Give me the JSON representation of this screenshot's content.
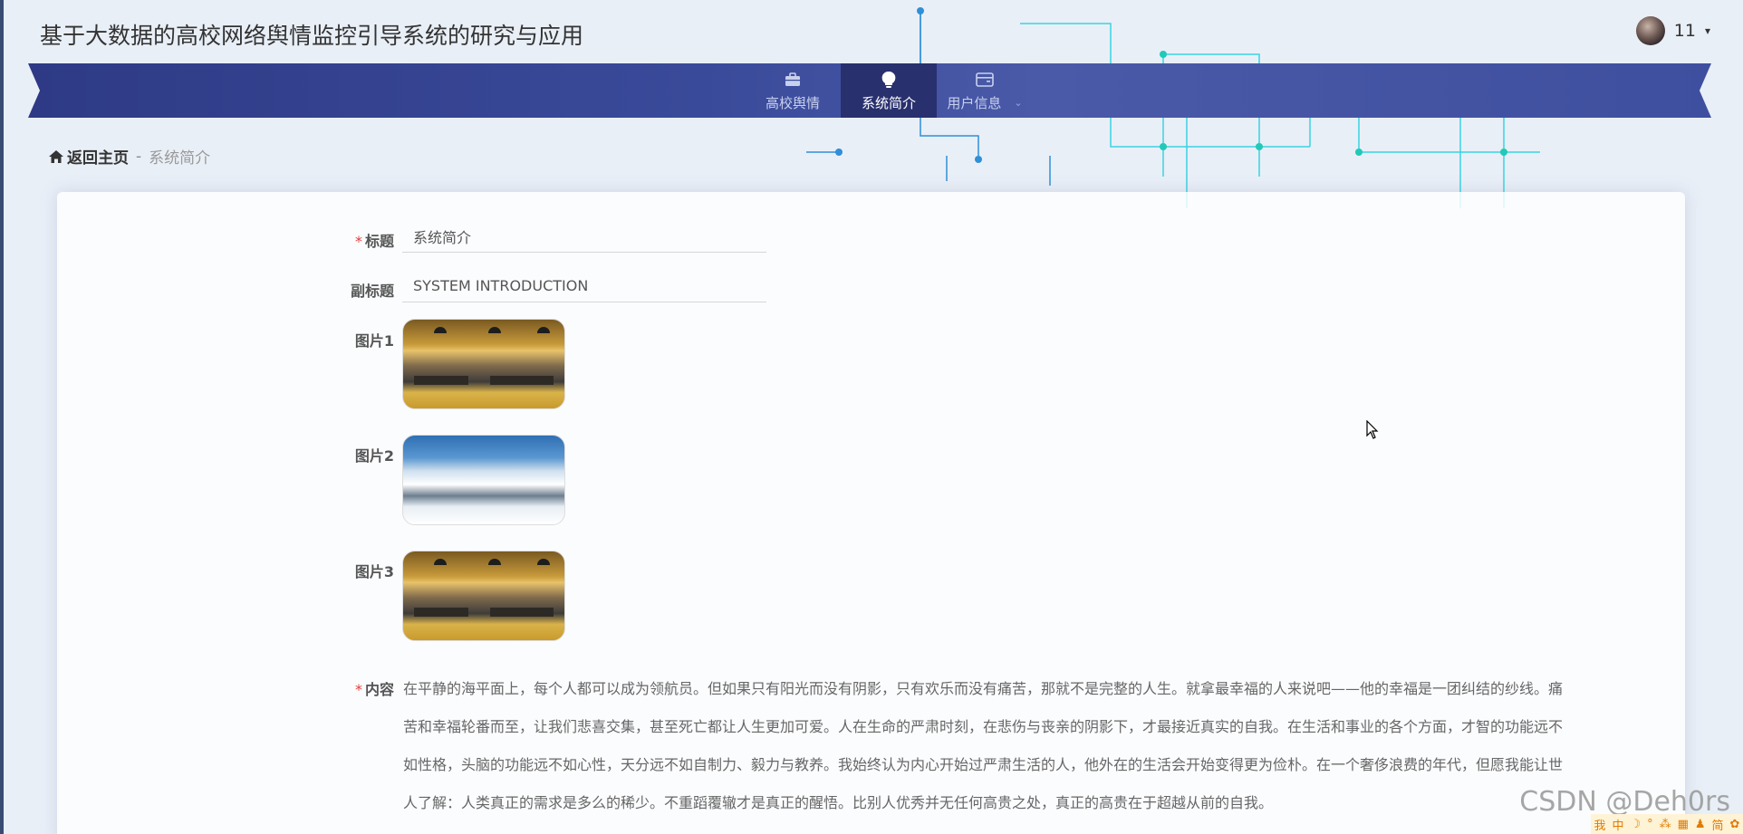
{
  "header": {
    "title": "基于大数据的高校网络舆情监控引导系统的研究与应用",
    "user_name": "11",
    "user_caret": "▾"
  },
  "nav": {
    "items": [
      {
        "label": "高校舆情",
        "icon": "briefcase-icon",
        "active": false
      },
      {
        "label": "系统简介",
        "icon": "lightbulb-icon",
        "active": true
      },
      {
        "label": "用户信息",
        "icon": "card-icon",
        "active": false,
        "has_dropdown": true
      }
    ],
    "dropdown_caret": "⌄"
  },
  "breadcrumb": {
    "home_label": "返回主页",
    "separator": "-",
    "current": "系统简介"
  },
  "form": {
    "title_label": "标题",
    "title_required": "*",
    "title_value": "系统简介",
    "subtitle_label": "副标题",
    "subtitle_value": "SYSTEM INTRODUCTION",
    "image1_label": "图片1",
    "image2_label": "图片2",
    "image3_label": "图片3",
    "content_label": "内容",
    "content_required": "*",
    "content_text": "在平静的海平面上，每个人都可以成为领航员。但如果只有阳光而没有阴影，只有欢乐而没有痛苦，那就不是完整的人生。就拿最幸福的人来说吧——他的幸福是一团纠结的纱线。痛苦和幸福轮番而至，让我们悲喜交集，甚至死亡都让人生更加可爱。人在生命的严肃时刻，在悲伤与丧亲的阴影下，才最接近真实的自我。在生活和事业的各个方面，才智的功能远不如性格，头脑的功能远不如心性，天分远不如自制力、毅力与教养。我始终认为内心开始过严肃生活的人，他外在的生活会开始变得更为俭朴。在一个奢侈浪费的年代，但愿我能让世人了解：人类真正的需求是多么的稀少。不重蹈覆辙才是真正的醒悟。比别人优秀并无任何高贵之处，真正的高贵在于超越从前的自我。"
  },
  "overlay": {
    "watermark": "CSDN @Deh0rs",
    "ime_items": [
      "我",
      "中",
      "☽",
      "°",
      "⁂",
      "▦",
      "♟",
      "简",
      "✿"
    ]
  },
  "colors": {
    "nav_bg": "#3a4a9a",
    "nav_active": "#29306e",
    "required": "#e63c3c"
  }
}
